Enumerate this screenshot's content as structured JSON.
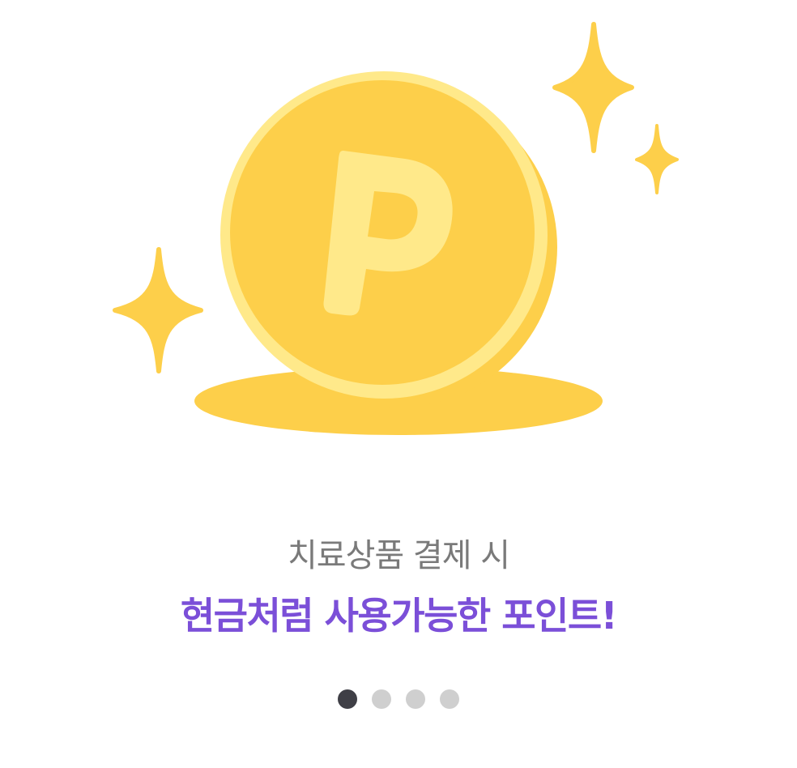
{
  "onboarding": {
    "subtitle": "치료상품 결제 시",
    "headline": "현금처럼 사용가능한 포인트!",
    "headline_color": "#7B4FD8",
    "illustration": {
      "icon": "point-coin-icon",
      "coin_letter": "P",
      "coin_color": "#FDCF4A",
      "coin_highlight": "#FFE98A",
      "sparkle_color": "#FDCF4A"
    },
    "pagination": {
      "total": 4,
      "active_index": 0,
      "active_color": "#3F3F46",
      "inactive_color": "#CFCFCF"
    }
  }
}
